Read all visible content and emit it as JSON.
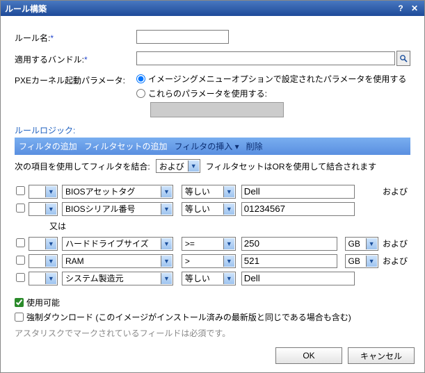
{
  "dialog": {
    "title": "ルール構築",
    "help_icon": "?",
    "close_icon": "✕"
  },
  "labels": {
    "rule_name": "ルール名:",
    "apply_bundle": "適用するバンドル:",
    "pxe_params": "PXEカーネル起動パラメータ:",
    "required_mark": "*"
  },
  "pxe": {
    "option1": "イメージングメニューオプションで設定されたパラメータを使用する",
    "option2": "これらのパラメータを使用する:"
  },
  "logic": {
    "heading": "ルールロジック:",
    "actions": {
      "add_filter": "フィルタの追加",
      "add_filter_set": "フィルタセットの追加",
      "insert_filter": "フィルタの挿入",
      "dropdown_glyph": "▾",
      "delete": "削除"
    },
    "combine_prefix": "次の項目を使用してフィルタを結合:",
    "combine_value": "および",
    "combine_suffix": "フィルタセットはORを使用して結合されます",
    "or_label": "又は"
  },
  "filters": [
    {
      "field": "BIOSアセットタグ",
      "op": "等しい",
      "value": "Dell",
      "unit": "",
      "conj": "および"
    },
    {
      "field": "BIOSシリアル番号",
      "op": "等しい",
      "value": "01234567",
      "unit": "",
      "conj": ""
    },
    {
      "field": "ハードドライブサイズ",
      "op": ">=",
      "value": "250",
      "unit": "GB",
      "conj": "および"
    },
    {
      "field": "RAM",
      "op": ">",
      "value": "521",
      "unit": "GB",
      "conj": "および"
    },
    {
      "field": "システム製造元",
      "op": "等しい",
      "value": "Dell",
      "unit": "",
      "conj": ""
    }
  ],
  "options": {
    "enabled_label": "使用可能",
    "force_download_label": "強制ダウンロード (このイメージがインストール済みの最新版と同じである場合も含む)"
  },
  "note": "アスタリスクでマークされているフィールドは必須です。",
  "buttons": {
    "ok": "OK",
    "cancel": "キャンセル"
  }
}
